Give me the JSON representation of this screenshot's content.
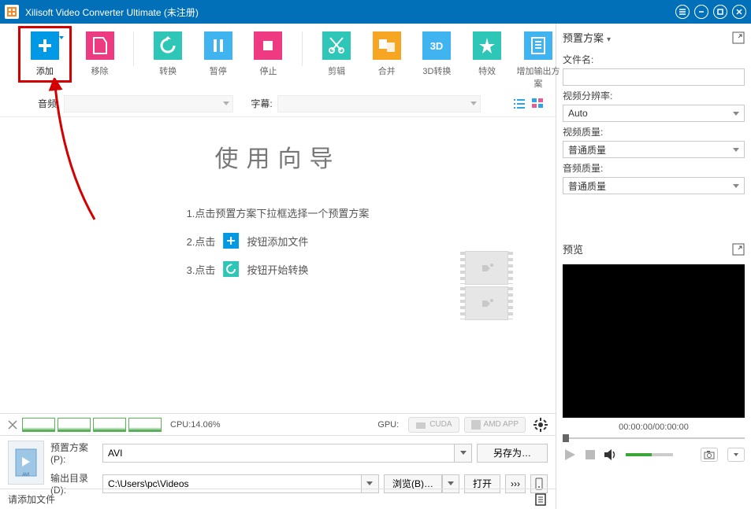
{
  "window": {
    "title": "Xilisoft Video Converter Ultimate (未注册)"
  },
  "toolbar": {
    "add": "添加",
    "remove": "移除",
    "convert": "转换",
    "pause": "暂停",
    "stop": "停止",
    "clip": "剪辑",
    "merge": "合并",
    "threed": "3D转换",
    "effect": "特效",
    "add_profile": "增加输出方案",
    "threed_icon_text": "3D"
  },
  "subbar": {
    "audio_label": "音频:",
    "subtitle_label": "字幕:"
  },
  "wizard": {
    "title": "使用向导",
    "step1": "1.点击预置方案下拉框选择一个预置方案",
    "step2a": "2.点击",
    "step2b": "按钮添加文件",
    "step3a": "3.点击",
    "step3b": "按钮开始转换"
  },
  "cpu": {
    "label": "CPU:14.06%",
    "gpu_label": "GPU:",
    "cuda": "CUDA",
    "amd": "AMD APP"
  },
  "profile": {
    "preset_label": "预置方案(P):",
    "preset_value": "AVI",
    "saveas": "另存为…",
    "output_label": "输出目录 (D):",
    "output_value": "C:\\Users\\pc\\Videos",
    "browse": "浏览(B)…",
    "open": "打开",
    "more": "›››"
  },
  "status": {
    "text": "请添加文件"
  },
  "right": {
    "preset_header": "预置方案",
    "filename_label": "文件名:",
    "resolution_label": "视频分辨率:",
    "resolution_value": "Auto",
    "video_quality_label": "视频质量:",
    "video_quality_value": "普通质量",
    "audio_quality_label": "音频质量:",
    "audio_quality_value": "普通质量",
    "preview_header": "预览",
    "time_current": "00:00:00",
    "time_separator": " / ",
    "time_total": "00:00:00"
  }
}
